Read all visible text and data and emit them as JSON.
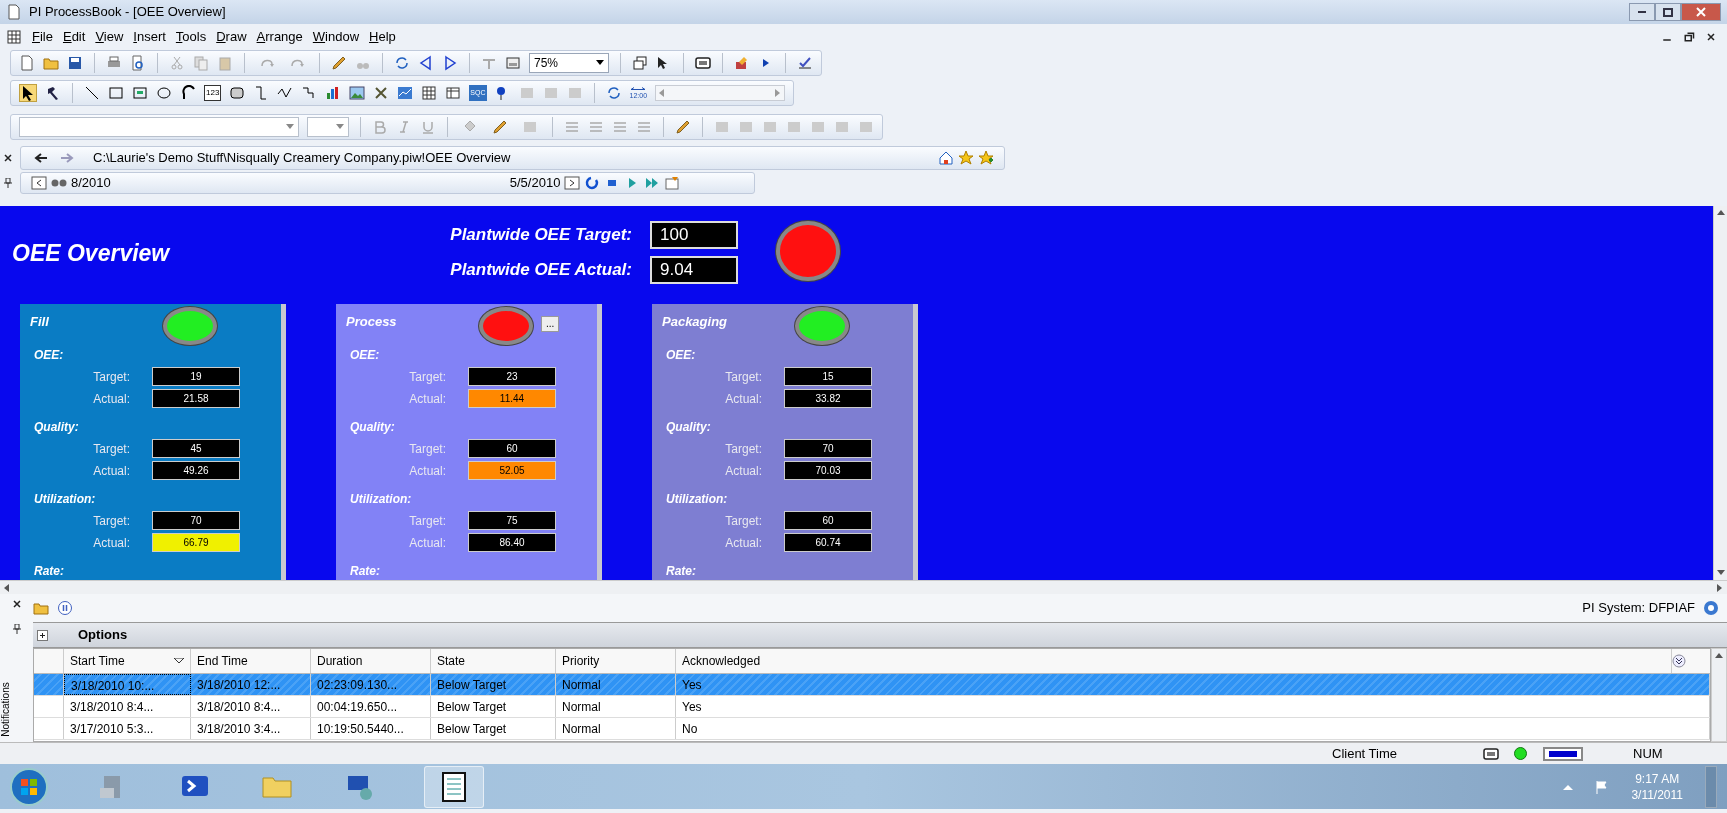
{
  "window": {
    "title": "PI ProcessBook - [OEE Overview]"
  },
  "menu": [
    "File",
    "Edit",
    "View",
    "Insert",
    "Tools",
    "Draw",
    "Arrange",
    "Window",
    "Help"
  ],
  "toolbar": {
    "zoom_value": "75%",
    "counter_icon_label": "123",
    "sqc_icon_label": "SQC",
    "time_icon_label": "12:00"
  },
  "address_bar": {
    "path": "C:\\Laurie's Demo Stuff\\Nisqually Creamery Company.piw!OEE Overview"
  },
  "time_bar": {
    "start": "8/2010",
    "end": "5/5/2010"
  },
  "display": {
    "title": "OEE Overview",
    "plantwide": [
      {
        "label": "Plantwide OEE Target:",
        "value": "100"
      },
      {
        "label": "Plantwide OEE Actual:",
        "value": "9.04"
      }
    ],
    "plantwide_alarm": true,
    "panels": [
      {
        "name": "Fill",
        "color": "#0a7cc4",
        "alarm": false,
        "has_details_button": false,
        "sections": [
          {
            "label": "OEE:",
            "rows": [
              {
                "label": "Target:",
                "value": "19",
                "color": "#000000"
              },
              {
                "label": "Actual:",
                "value": "21.58",
                "color": "#000000"
              }
            ]
          },
          {
            "label": "Quality:",
            "rows": [
              {
                "label": "Target:",
                "value": "45",
                "color": "#000000"
              },
              {
                "label": "Actual:",
                "value": "49.26",
                "color": "#000000"
              }
            ]
          },
          {
            "label": "Utilization:",
            "rows": [
              {
                "label": "Target:",
                "value": "70",
                "color": "#000000"
              },
              {
                "label": "Actual:",
                "value": "66.79",
                "color": "#f0f000"
              }
            ]
          },
          {
            "label": "Rate:"
          }
        ]
      },
      {
        "name": "Process",
        "color": "#8282f6",
        "alarm": true,
        "has_details_button": true,
        "details_button_label": "...",
        "sections": [
          {
            "label": "OEE:",
            "rows": [
              {
                "label": "Target:",
                "value": "23",
                "color": "#000000"
              },
              {
                "label": "Actual:",
                "value": "11.44",
                "color": "#ff8800"
              }
            ]
          },
          {
            "label": "Quality:",
            "rows": [
              {
                "label": "Target:",
                "value": "60",
                "color": "#000000"
              },
              {
                "label": "Actual:",
                "value": "52.05",
                "color": "#ff8800"
              }
            ]
          },
          {
            "label": "Utilization:",
            "rows": [
              {
                "label": "Target:",
                "value": "75",
                "color": "#000000"
              },
              {
                "label": "Actual:",
                "value": "86.40",
                "color": "#000000"
              }
            ]
          },
          {
            "label": "Rate:"
          }
        ]
      },
      {
        "name": "Packaging",
        "color": "#7e7ed2",
        "alarm": false,
        "has_details_button": false,
        "sections": [
          {
            "label": "OEE:",
            "rows": [
              {
                "label": "Target:",
                "value": "15",
                "color": "#000000"
              },
              {
                "label": "Actual:",
                "value": "33.82",
                "color": "#000000"
              }
            ]
          },
          {
            "label": "Quality:",
            "rows": [
              {
                "label": "Target:",
                "value": "70",
                "color": "#000000"
              },
              {
                "label": "Actual:",
                "value": "70.03",
                "color": "#000000"
              }
            ]
          },
          {
            "label": "Utilization:",
            "rows": [
              {
                "label": "Target:",
                "value": "60",
                "color": "#000000"
              },
              {
                "label": "Actual:",
                "value": "60.74",
                "color": "#000000"
              }
            ]
          },
          {
            "label": "Rate:"
          }
        ]
      }
    ]
  },
  "notifications": {
    "side_label": "Notifications",
    "server": "PI System: DFPIAF",
    "options_label": "Options",
    "columns": [
      "Start Time",
      "End Time",
      "Duration",
      "State",
      "Priority",
      "Acknowledged"
    ],
    "rows": [
      {
        "selected": true,
        "cells": [
          "3/18/2010 10:...",
          "3/18/2010 12:...",
          "02:23:09.130...",
          "Below Target",
          "Normal",
          "Yes"
        ]
      },
      {
        "selected": false,
        "cells": [
          "3/18/2010 8:4...",
          "3/18/2010 8:4...",
          "00:04:19.650...",
          "Below Target",
          "Normal",
          "Yes"
        ]
      },
      {
        "selected": false,
        "cells": [
          "3/17/2010 5:3...",
          "3/18/2010 3:4...",
          "10:19:50.5440...",
          "Below Target",
          "Normal",
          "No"
        ]
      }
    ]
  },
  "status_bar": {
    "time_mode": "Client Time",
    "num_lock": "NUM"
  },
  "taskbar": {
    "time": "9:17 AM",
    "date": "3/11/2011"
  }
}
